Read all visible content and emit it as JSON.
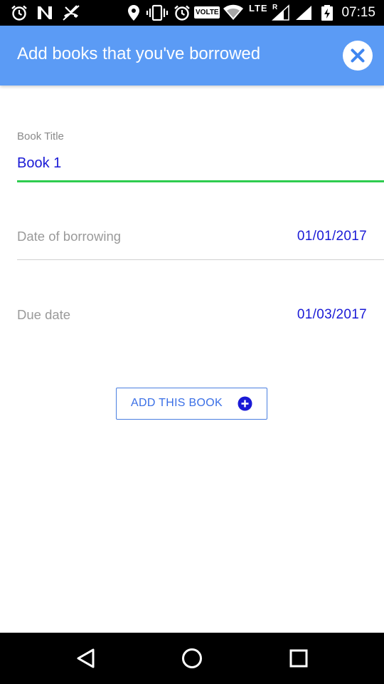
{
  "status_bar": {
    "time": "07:15",
    "volte": "VOLTE",
    "network": "LTE",
    "roaming": "R",
    "icons": [
      "alarm-icon",
      "n-notification-icon",
      "missed-call-icon",
      "location-icon",
      "vibrate-icon",
      "alarm-icon",
      "wifi-icon",
      "signal-icon",
      "signal-icon",
      "battery-charging-icon"
    ]
  },
  "app_bar": {
    "title": "Add books that you've borrowed",
    "close_icon": "close-icon",
    "color": "#5b9bf5"
  },
  "form": {
    "book_title": {
      "label": "Book Title",
      "value": "Book 1"
    },
    "borrow_date": {
      "label": "Date of borrowing",
      "value": "01/01/2017"
    },
    "due_date": {
      "label": "Due date",
      "value": "01/03/2017"
    },
    "add_button": {
      "label": "ADD THIS BOOK",
      "icon": "add-circle-icon"
    },
    "accent": "#1a1ad6",
    "focus_underline": "#2ecc4f"
  },
  "nav_bar": {
    "back_icon": "back-triangle-icon",
    "home_icon": "home-circle-icon",
    "recents_icon": "recents-square-icon"
  }
}
